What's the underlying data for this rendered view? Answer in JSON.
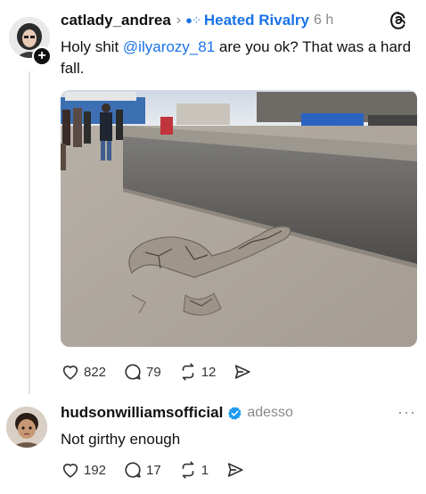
{
  "post1": {
    "username": "catlady_andrea",
    "community_icon": "community-dots-icon",
    "community": "Heated Rivalry",
    "time": "6 h",
    "text_before": "Holy shit ",
    "mention": "@ilyarozy_81",
    "text_after": " are you ok? That was a hard fall.",
    "image_alt": "photo",
    "likes": "822",
    "replies": "79",
    "reposts": "12"
  },
  "post2": {
    "username": "hudsonwilliamsofficial",
    "handle": "adesso",
    "text": "Not girthy enough",
    "likes": "192",
    "replies": "17",
    "reposts": "1"
  },
  "colors": {
    "link": "#1a73e8",
    "verified": "#1d9bf0",
    "muted": "#8a8a8a"
  }
}
